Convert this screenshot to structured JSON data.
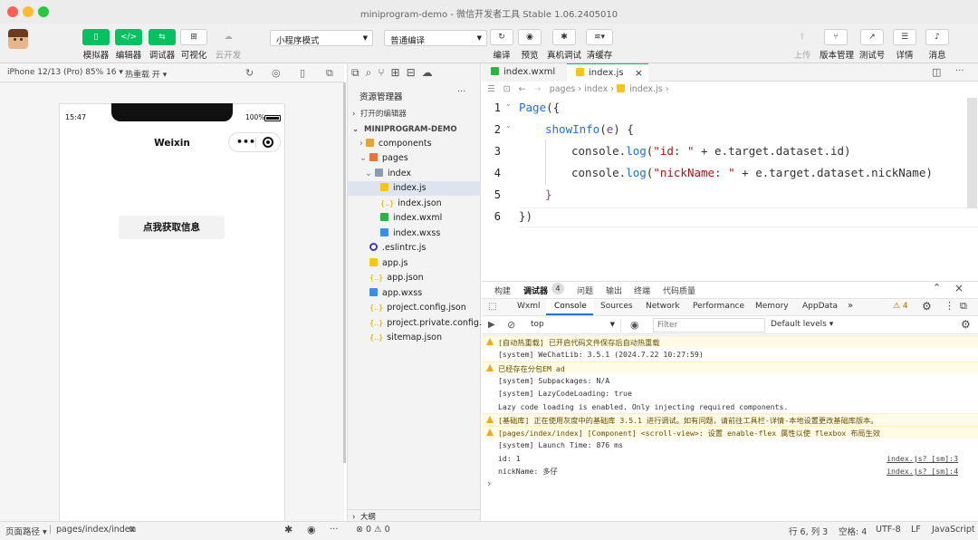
{
  "window": {
    "title": "miniprogram-demo - 微信开发者工具 Stable 1.06.2405010"
  },
  "toolbar": {
    "simulator": "模拟器",
    "editor": "编辑器",
    "debugger": "调试器",
    "visual": "可视化",
    "cloud": "云开发",
    "mode_select": "小程序模式",
    "compile_select": "普通编译",
    "compile": "编译",
    "preview": "预览",
    "real_debug": "真机调试",
    "clear_cache": "清缓存",
    "upload": "上传",
    "version": "版本管理",
    "test": "测试号",
    "details": "详情",
    "messages": "消息"
  },
  "simulator": {
    "device": "iPhone 12/13 (Pro) 85% 16 ▾",
    "hot_reload": "热重载 开 ▾",
    "status_time": "15:47",
    "battery": "100%",
    "nav_title": "Weixin",
    "button_label": "点我获取信息"
  },
  "explorer": {
    "title": "资源管理器",
    "open_editors": "打开的编辑器",
    "project": "MINIPROGRAM-DEMO",
    "items": [
      {
        "label": "components",
        "type": "folder"
      },
      {
        "label": "pages",
        "type": "folder"
      },
      {
        "label": "index",
        "type": "folder"
      },
      {
        "label": "index.js",
        "type": "js"
      },
      {
        "label": "index.json",
        "type": "json"
      },
      {
        "label": "index.wxml",
        "type": "wxml"
      },
      {
        "label": "index.wxss",
        "type": "wxss"
      },
      {
        "label": ".eslintrc.js",
        "type": "eslint"
      },
      {
        "label": "app.js",
        "type": "js"
      },
      {
        "label": "app.json",
        "type": "json"
      },
      {
        "label": "app.wxss",
        "type": "wxss"
      },
      {
        "label": "project.config.json",
        "type": "json"
      },
      {
        "label": "project.private.config...",
        "type": "json"
      },
      {
        "label": "sitemap.json",
        "type": "json"
      }
    ],
    "outline": "大纲",
    "problems": "⊗ 0 ⚠ 0"
  },
  "editor": {
    "tabs": [
      "index.wxml",
      "index.js"
    ],
    "breadcrumb": [
      "pages",
      "index",
      "index.js",
      ""
    ],
    "line_numbers": [
      "1",
      "2",
      "3",
      "4",
      "5",
      "6"
    ],
    "code": {
      "l1a": "Page",
      "l1b": "({",
      "l2a": "showInfo",
      "l2b": "(",
      "l2c": "e",
      "l2d": ") {",
      "l3a": "console.",
      "l3b": "log",
      "l3c": "(",
      "l3d": "\"id: \"",
      "l3e": " + e.target.dataset.id)",
      "l4a": "console.",
      "l4b": "log",
      "l4c": "(",
      "l4d": "\"nickName: \"",
      "l4e": " + e.target.dataset.nickName)",
      "l5": "}",
      "l6": "})"
    }
  },
  "console": {
    "panel_tabs": [
      "构建",
      "调试器",
      "问题",
      "输出",
      "终端",
      "代码质量"
    ],
    "debugger_badge": "4",
    "dev_tabs": [
      "Wxml",
      "Console",
      "Sources",
      "Network",
      "Performance",
      "Memory",
      "AppData",
      "»"
    ],
    "warn_count": "⚠ 4",
    "context": "top",
    "filter_placeholder": "Filter",
    "levels": "Default levels ▾",
    "lines": [
      {
        "text": "[自动热重载] 已开启代码文件保存后自动热重载",
        "warn": true,
        "src": ""
      },
      {
        "text": "[system] WeChatLib: 3.5.1 (2024.7.22 10:27:59)",
        "warn": false,
        "src": ""
      },
      {
        "text": "已经存在分包EM ad",
        "warn": true,
        "src": ""
      },
      {
        "text": "[system] Subpackages: N/A",
        "warn": false,
        "src": ""
      },
      {
        "text": "[system] LazyCodeLoading: true",
        "warn": false,
        "src": ""
      },
      {
        "text": "Lazy code loading is enabled. Only injecting required components.",
        "warn": false,
        "src": ""
      },
      {
        "text": "[基础库] 正在使用灰度中的基础库 3.5.1 进行调试。如有问题，请前往工具栏-详情-本地设置更改基础库版本。",
        "warn": true,
        "src": ""
      },
      {
        "text": "[pages/index/index] [Component] <scroll-view>: 设置 enable-flex 属性以使 flexbox 布局生效",
        "warn": true,
        "src": ""
      },
      {
        "text": "[system] Launch Time: 876 ms",
        "warn": false,
        "src": ""
      },
      {
        "text": "id: 1",
        "warn": false,
        "src": "index.js? [sm]:3"
      },
      {
        "text": "nickName: 多仔",
        "warn": false,
        "src": "index.js? [sm]:4"
      }
    ],
    "prompt": "›"
  },
  "statusbar": {
    "page_path_label": "页面路径 ▾",
    "page_path": "pages/index/index",
    "cursor": "行 6, 列 3",
    "indent": "空格: 4",
    "encoding": "UTF-8",
    "eol": "LF",
    "language": "JavaScript"
  },
  "colors": {
    "green": "#07c160",
    "keyword": "#7a3e9d",
    "string": "#a31515",
    "warn_bg": "#fffbe6"
  }
}
